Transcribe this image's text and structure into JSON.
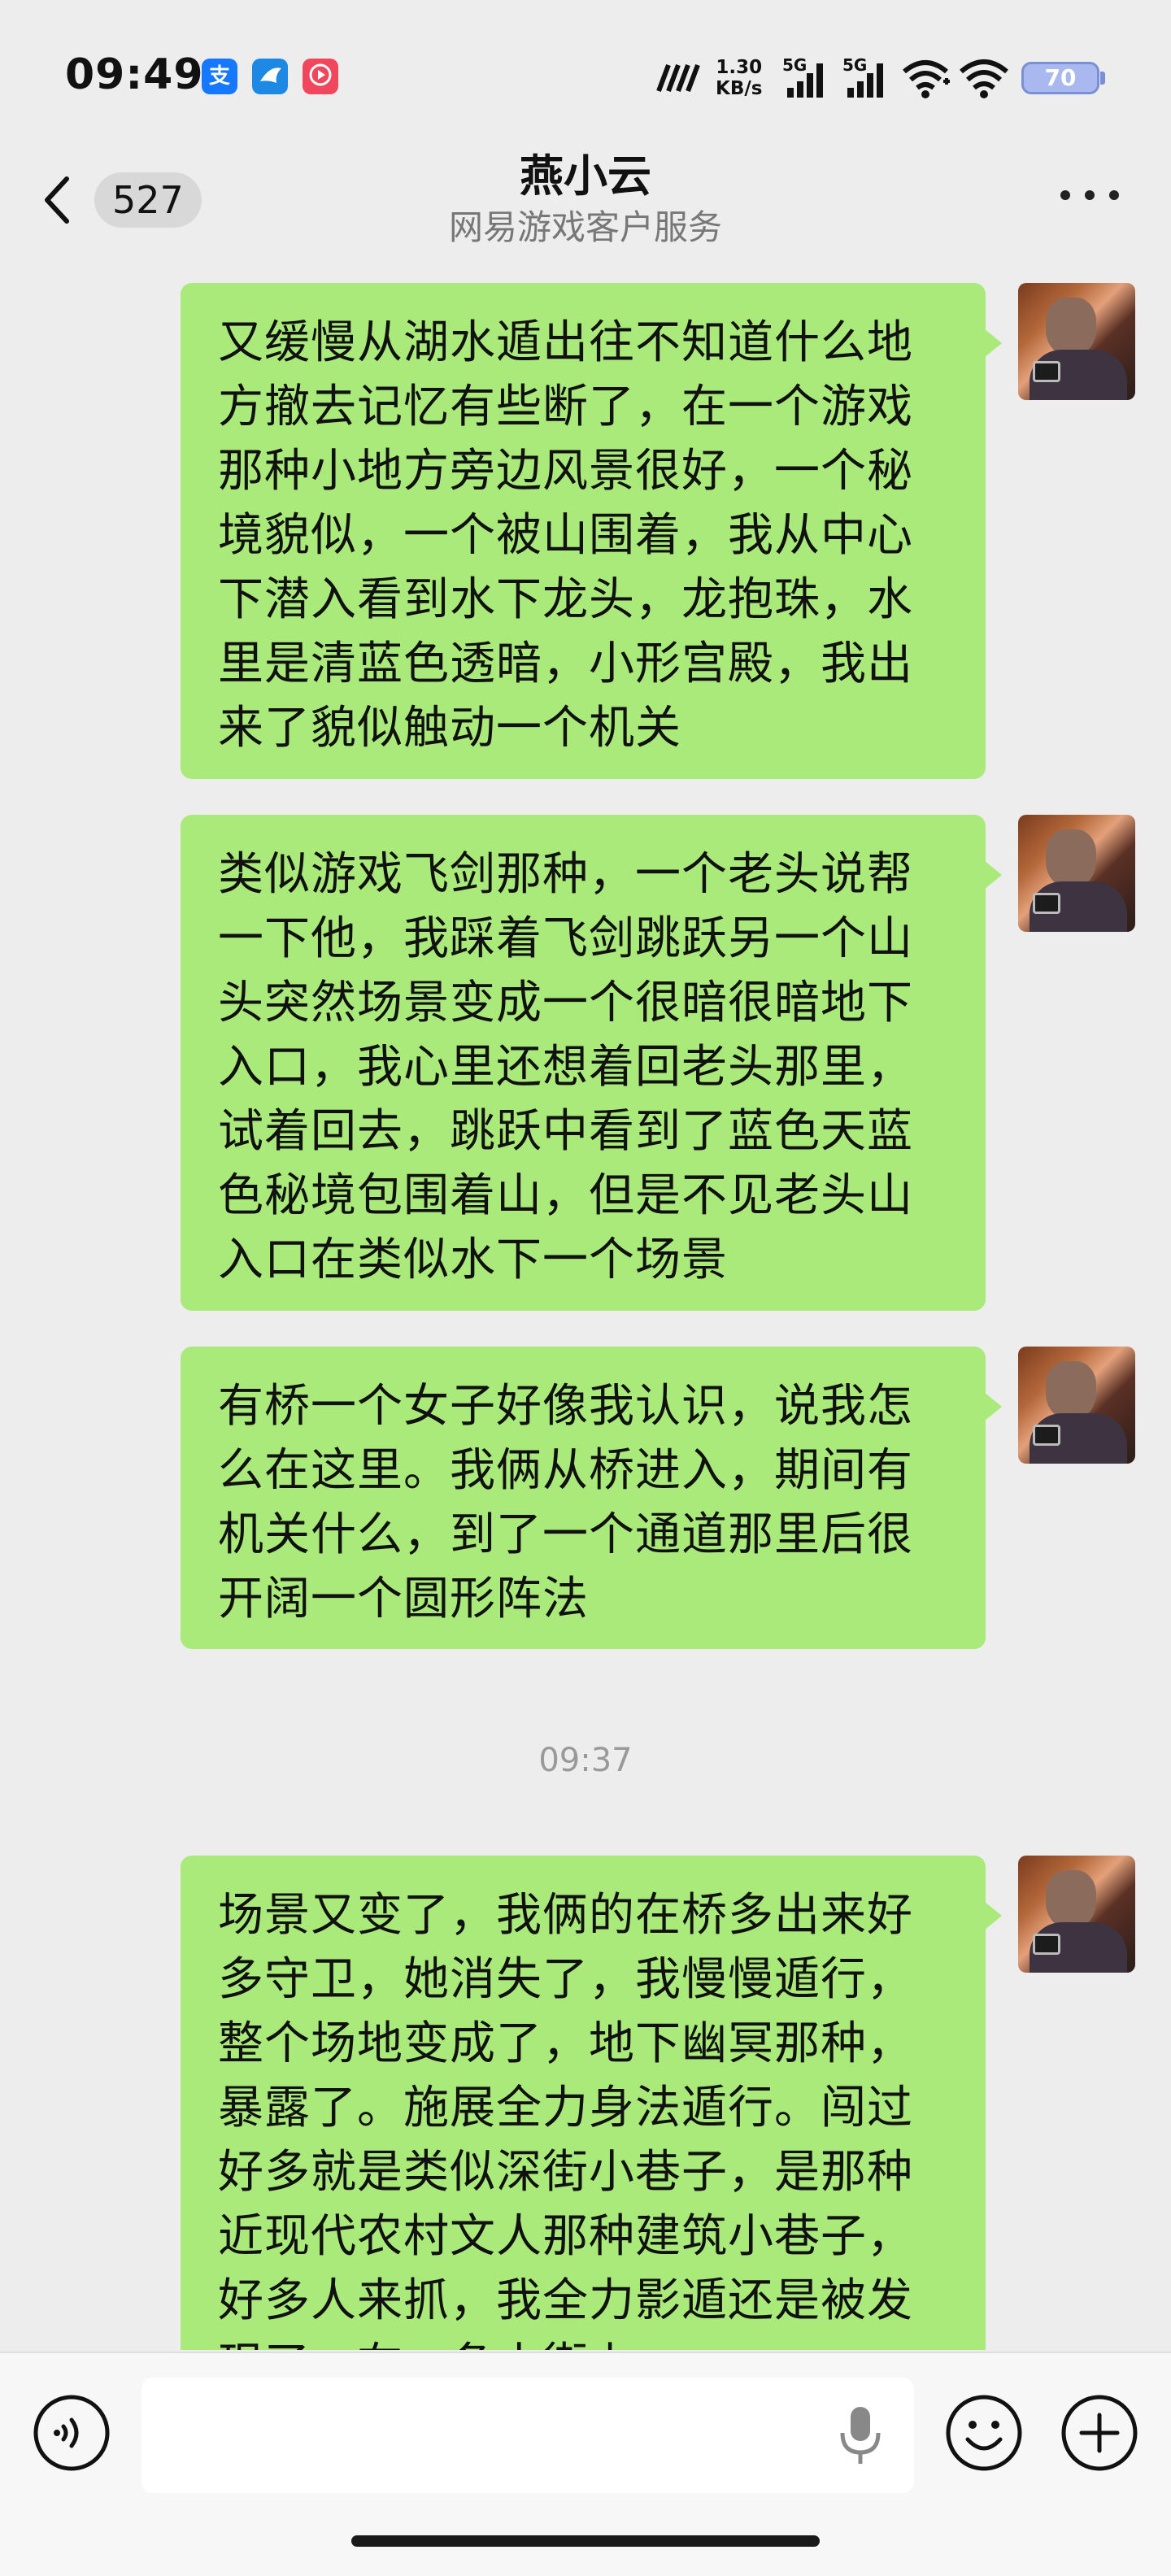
{
  "status_bar": {
    "time": "09:49",
    "alipay_glyph": "支",
    "net_speed_value": "1.30",
    "net_speed_unit": "KB/s",
    "sim1_label": "5G",
    "sim2_label": "5G",
    "battery_level": "70"
  },
  "header": {
    "back_count": "527",
    "title": "燕小云",
    "subtitle": "网易游戏客户服务",
    "more_icon": "more-horizontal-icon"
  },
  "messages": [
    {
      "type": "outgoing",
      "text": "又缓慢从湖水遁出往不知道什么地方撤去记忆有些断了，在一个游戏那种小地方旁边风景很好，一个秘境貌似，一个被山围着，我从中心下潜入看到水下龙头，龙抱珠，水里是清蓝色透暗，小形宫殿，我出来了貌似触动一个机关"
    },
    {
      "type": "outgoing",
      "text": "类似游戏飞剑那种，一个老头说帮一下他，我踩着飞剑跳跃另一个山头突然场景变成一个很暗很暗地下入口，我心里还想着回老头那里，试着回去，跳跃中看到了蓝色天蓝色秘境包围着山，但是不见老头山入口在类似水下一个场景"
    },
    {
      "type": "outgoing",
      "text": "有桥一个女子好像我认识，说我怎么在这里。我俩从桥进入，期间有机关什么，到了一个通道那里后很开阔一个圆形阵法"
    },
    {
      "type": "timestamp",
      "text": "09:37"
    },
    {
      "type": "outgoing",
      "text": "场景又变了，我俩的在桥多出来好多守卫，她消失了，我慢慢遁行，整个场地变成了，地下幽冥那种，暴露了。施展全力身法遁行。闯过好多就是类似深街小巷子，是那种近现代农村文人那种建筑小巷子，好多人来抓，我全力影遁还是被发现了，在一条小街上"
    }
  ],
  "input_bar": {
    "voice_icon": "voice-mode-icon",
    "mic_icon": "microphone-icon",
    "emoji_icon": "emoji-icon",
    "plus_icon": "plus-circle-icon"
  }
}
